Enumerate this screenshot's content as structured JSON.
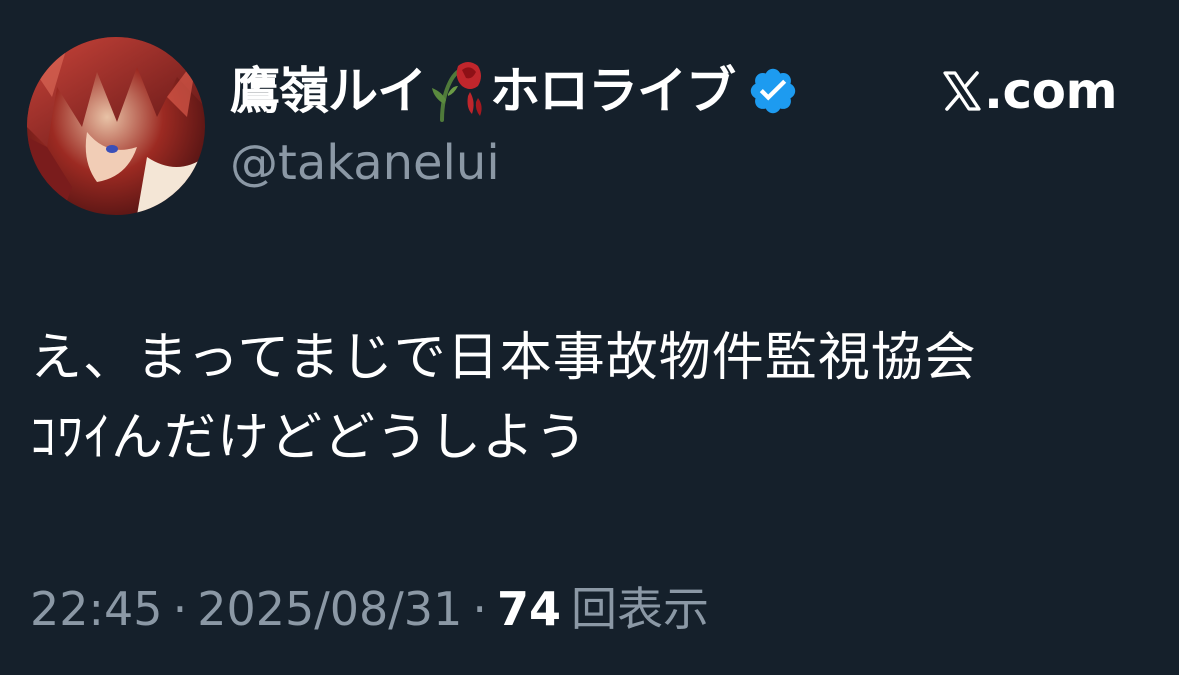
{
  "tweet": {
    "author": {
      "display_name": "鷹嶺ルイ",
      "affiliation": "ホロライブ",
      "handle": "@takanelui",
      "verified": true,
      "badge_icon": "verified-badge-icon",
      "name_emoji": "wilted-rose-icon"
    },
    "source": {
      "logo_icon": "x-logo-icon",
      "domain": ".com"
    },
    "text_lines": [
      "え、まってまじで日本事故物件監視協会",
      "ｺﾜｲんだけどどうしよう"
    ],
    "time": "22:45",
    "separator": "·",
    "date": "2025/08/31",
    "views_count": "74",
    "views_label": "回表示"
  },
  "colors": {
    "background": "#15202b",
    "primary_text": "#ffffff",
    "secondary_text": "#8b98a5",
    "verified_blue": "#1d9bf0"
  }
}
